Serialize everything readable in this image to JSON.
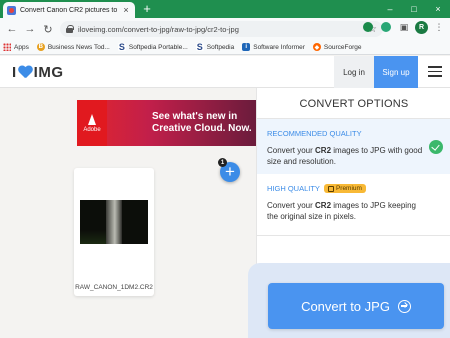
{
  "browser": {
    "tab_title": "Convert Canon CR2 pictures to JP",
    "tab_close": "×",
    "new_tab": "+",
    "url": "iloveimg.com/convert-to-jpg/raw-to-jpg/cr2-to-jpg",
    "profile_initial": "R",
    "window_controls": [
      "–",
      "□",
      "×"
    ],
    "bookmarks": [
      {
        "label": "Apps",
        "icon": "apps-grid-icon",
        "color": "#d33b2f"
      },
      {
        "label": "Business News Tod...",
        "icon": "business-news-icon",
        "color": "#e7a01f"
      },
      {
        "label": "Softpedia Portable...",
        "icon": "softpedia-icon",
        "color": "#2a4a8a"
      },
      {
        "label": "Softpedia",
        "icon": "softpedia-icon",
        "color": "#2a4a8a"
      },
      {
        "label": "Software Informer",
        "icon": "software-informer-icon",
        "color": "#1e66b8"
      },
      {
        "label": "SourceForge",
        "icon": "sourceforge-icon",
        "color": "#ff6600"
      }
    ]
  },
  "header": {
    "logo_left": "I",
    "logo_right": "IMG",
    "login": "Log in",
    "signup": "Sign up"
  },
  "ad": {
    "brand": "Adobe",
    "line1": "See what's new in",
    "line2": "Creative Cloud. Now."
  },
  "workspace": {
    "file_count": "1",
    "add_label": "+",
    "file_name": "RAW_CANON_1DM2.CR2"
  },
  "panel": {
    "title": "CONVERT OPTIONS",
    "recommended": {
      "label": "RECOMMENDED QUALITY",
      "desc_pre": "Convert your ",
      "desc_bold": "CR2",
      "desc_post": " images to JPG with good size and resolution."
    },
    "high": {
      "label": "HIGH QUALITY",
      "badge": "Premium",
      "desc_pre": "Convert your ",
      "desc_bold": "CR2",
      "desc_post": " images to JPG keeping the original size in pixels."
    },
    "convert_button": "Convert to JPG"
  },
  "colors": {
    "accent": "#4a94f0",
    "brand_red": "#e5322d",
    "premium": "#f8b936",
    "selected_bg": "#eef5fd"
  }
}
